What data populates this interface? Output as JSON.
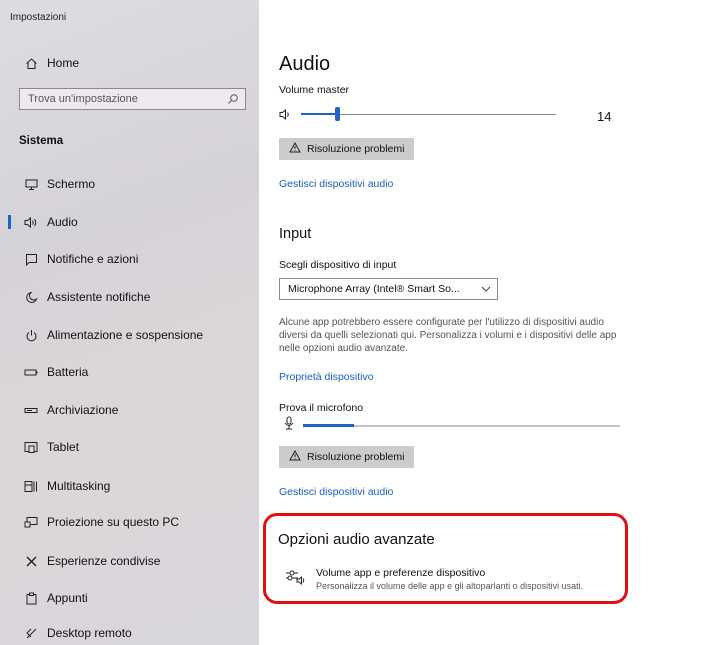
{
  "window": {
    "title": "Impostazioni"
  },
  "sidebar": {
    "home_label": "Home",
    "search_placeholder": "Trova un'impostazione",
    "section_title": "Sistema",
    "items": [
      {
        "label": "Schermo",
        "icon": "monitor-icon"
      },
      {
        "label": "Audio",
        "icon": "speaker-icon",
        "active": true
      },
      {
        "label": "Notifiche e azioni",
        "icon": "notifications-icon"
      },
      {
        "label": "Assistente notifiche",
        "icon": "moon-icon"
      },
      {
        "label": "Alimentazione e sospensione",
        "icon": "power-icon"
      },
      {
        "label": "Batteria",
        "icon": "battery-icon"
      },
      {
        "label": "Archiviazione",
        "icon": "storage-icon"
      },
      {
        "label": "Tablet",
        "icon": "tablet-icon"
      },
      {
        "label": "Multitasking",
        "icon": "multitasking-icon"
      },
      {
        "label": "Proiezione su questo PC",
        "icon": "projection-icon"
      },
      {
        "label": "Esperienze condivise",
        "icon": "shared-experiences-icon"
      },
      {
        "label": "Appunti",
        "icon": "clipboard-icon"
      },
      {
        "label": "Desktop remoto",
        "icon": "remote-desktop-icon"
      }
    ]
  },
  "output": {
    "title": "Audio",
    "volume_label": "Volume master",
    "volume_value": "14",
    "volume_level": 0.14,
    "troubleshoot_label": "Risoluzione problemi",
    "manage_devices_link": "Gestisci dispositivi audio"
  },
  "input": {
    "title": "Input",
    "choose_device_label": "Scegli dispositivo di input",
    "selected_device": "Microphone Array (Intel® Smart So...",
    "description": "Alcune app potrebbero essere configurate per l'utilizzo di dispositivi audio diversi da quelli selezionati qui. Personalizza i volumi e i dispositivi delle app nelle opzioni audio avanzate.",
    "properties_link": "Proprietà dispositivo",
    "test_mic_label": "Prova il microfono",
    "mic_level": 0.16,
    "troubleshoot_label": "Risoluzione problemi",
    "manage_devices_link": "Gestisci dispositivi audio"
  },
  "advanced": {
    "title": "Opzioni audio avanzate",
    "item_title": "Volume app e preferenze dispositivo",
    "item_desc": "Personalizza il volume delle app e gli altoparlanti o dispositivi usati."
  },
  "colors": {
    "accent": "#1e64c8",
    "link": "#1560bd",
    "highlight": "#e01010"
  }
}
